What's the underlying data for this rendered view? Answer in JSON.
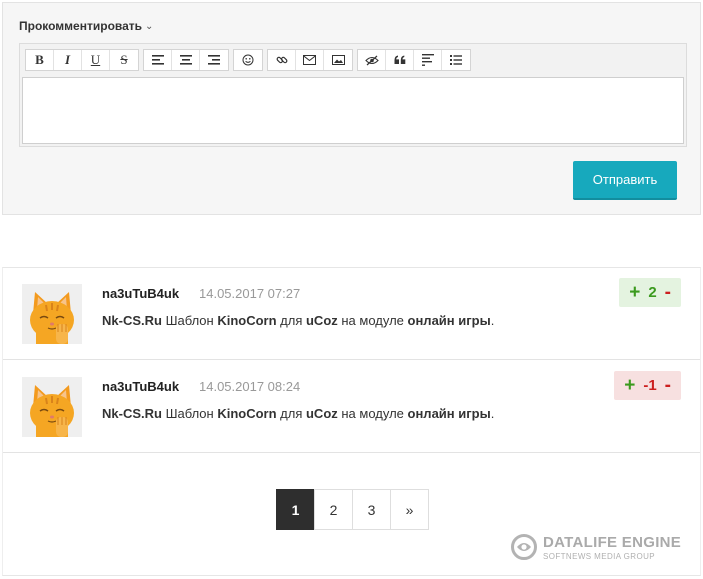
{
  "form": {
    "title": "Прокомментировать",
    "submit_label": "Отправить",
    "textarea_value": "",
    "toolbar": {
      "bold": "B",
      "italic": "I",
      "underline": "U",
      "strike": "S"
    }
  },
  "comments": [
    {
      "author": "na3uTuB4uk",
      "date": "14.05.2017 07:27",
      "text_parts": [
        "Nk-CS.Ru",
        " Шаблон ",
        "KinoCorn",
        " для ",
        "uCoz",
        " на модуле ",
        "онлайн игры",
        "."
      ],
      "rating": "2",
      "rating_plus": "+",
      "rating_minus": "-",
      "rating_tone": "positive"
    },
    {
      "author": "na3uTuB4uk",
      "date": "14.05.2017 08:24",
      "text_parts": [
        "Nk-CS.Ru",
        " Шаблон ",
        "KinoCorn",
        " для ",
        "uCoz",
        " на модуле ",
        "онлайн игры",
        "."
      ],
      "rating": "-1",
      "rating_plus": "+",
      "rating_minus": "-",
      "rating_tone": "negative"
    }
  ],
  "pagination": {
    "pages": [
      "1",
      "2",
      "3"
    ],
    "next": "»",
    "active": "1"
  },
  "logo": {
    "title": "DATALIFE ENGINE",
    "subtitle": "SOFTNEWS MEDIA GROUP"
  },
  "colors": {
    "accent": "#17a9bd",
    "positive": "#3b9a1e",
    "negative": "#cc1f1f"
  }
}
